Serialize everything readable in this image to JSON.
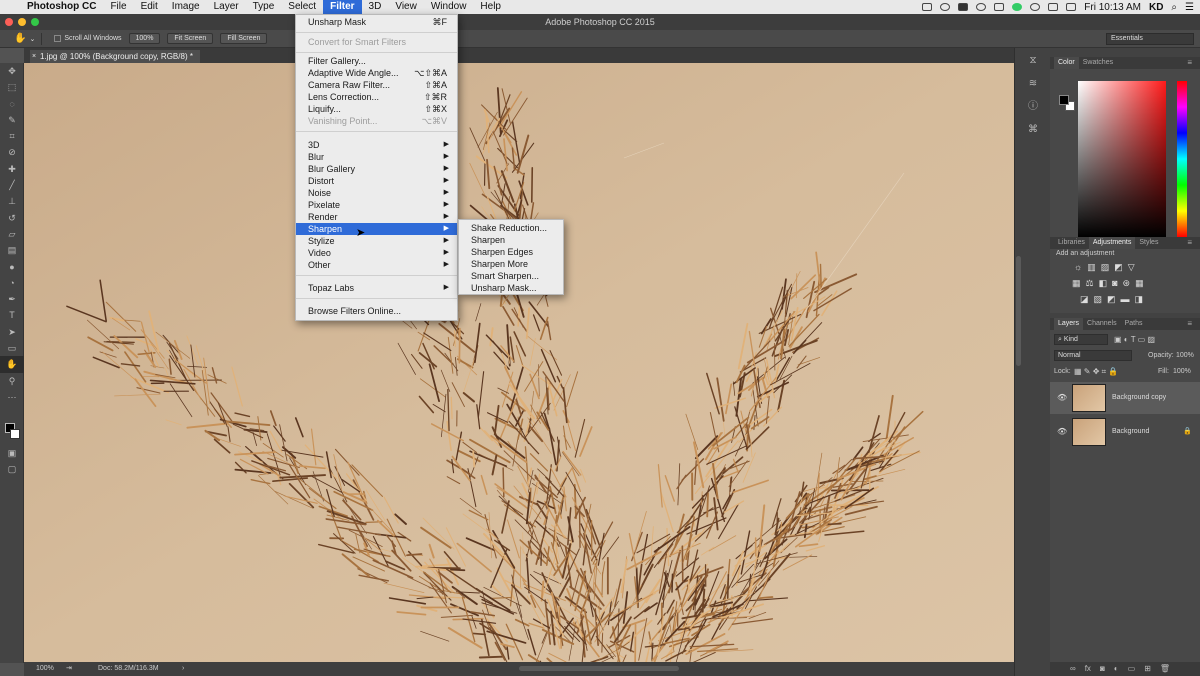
{
  "menubar": {
    "app": "Photoshop CC",
    "items": [
      "File",
      "Edit",
      "Image",
      "Layer",
      "Type",
      "Select",
      "Filter",
      "3D",
      "View",
      "Window",
      "Help"
    ],
    "active": "Filter",
    "clock": "Fri 10:13 AM",
    "user": "KD"
  },
  "window": {
    "title": "Adobe Photoshop CC 2015"
  },
  "options": {
    "scroll_all": "Scroll All Windows",
    "zoom": "100%",
    "fit": "Fit Screen",
    "fill": "Fill Screen",
    "workspace": "Essentials"
  },
  "document": {
    "tab": "1.jpg @ 100% (Background copy, RGB/8) *"
  },
  "status": {
    "zoom": "100%",
    "doc": "Doc: 58.2M/116.3M"
  },
  "filter_menu": {
    "last_filter": {
      "label": "Unsharp Mask",
      "shortcut": "⌘F"
    },
    "convert": "Convert for Smart Filters",
    "gallery": "Filter Gallery...",
    "adaptive": {
      "label": "Adaptive Wide Angle...",
      "shortcut": "⌥⇧⌘A"
    },
    "camera_raw": {
      "label": "Camera Raw Filter...",
      "shortcut": "⇧⌘A"
    },
    "lens": {
      "label": "Lens Correction...",
      "shortcut": "⇧⌘R"
    },
    "liquify": {
      "label": "Liquify...",
      "shortcut": "⇧⌘X"
    },
    "vanishing": {
      "label": "Vanishing Point...",
      "shortcut": "⌥⌘V"
    },
    "groups": [
      "3D",
      "Blur",
      "Blur Gallery",
      "Distort",
      "Noise",
      "Pixelate",
      "Render",
      "Sharpen",
      "Stylize",
      "Video",
      "Other"
    ],
    "topaz": "Topaz Labs",
    "browse": "Browse Filters Online..."
  },
  "sharpen_submenu": [
    "Shake Reduction...",
    "Sharpen",
    "Sharpen Edges",
    "Sharpen More",
    "Smart Sharpen...",
    "Unsharp Mask..."
  ],
  "panels": {
    "color_tabs": [
      "Color",
      "Swatches"
    ],
    "adj_tabs": [
      "Libraries",
      "Adjustments",
      "Styles"
    ],
    "adj_label": "Add an adjustment",
    "layer_tabs": [
      "Layers",
      "Channels",
      "Paths"
    ],
    "kind": "Kind",
    "blend": "Normal",
    "opacity_label": "Opacity:",
    "opacity": "100%",
    "lock_label": "Lock:",
    "fill_label": "Fill:",
    "fill": "100%",
    "layers": [
      {
        "name": "Background copy",
        "selected": true
      },
      {
        "name": "Background",
        "selected": false
      }
    ]
  }
}
